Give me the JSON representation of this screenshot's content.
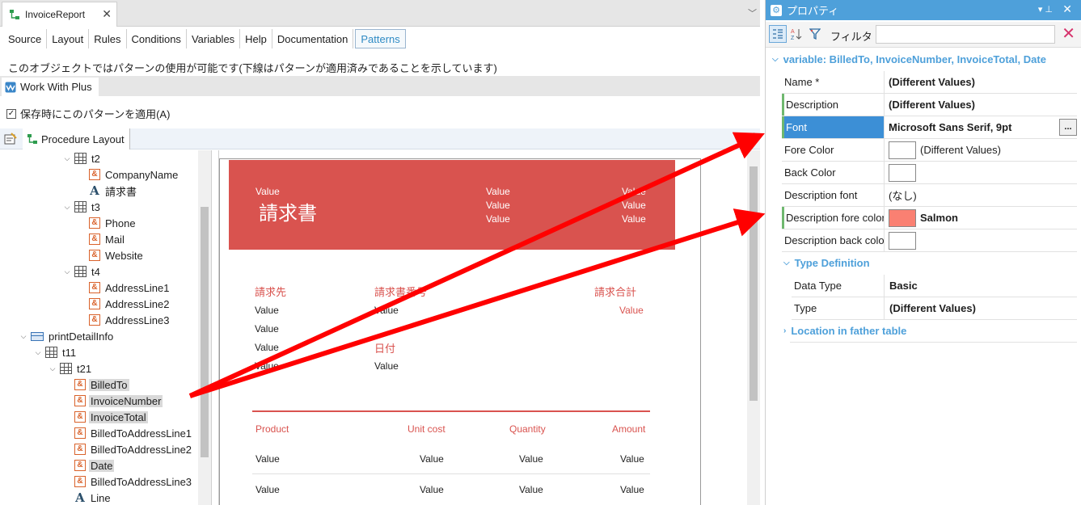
{
  "document_tab": {
    "title": "InvoiceReport"
  },
  "part_tabs": [
    "Source",
    "Layout",
    "Rules",
    "Conditions",
    "Variables",
    "Help",
    "Documentation",
    "Patterns"
  ],
  "pattern_info": "このオブジェクトではパターンの使用が可能です(下線はパターンが適用済みであることを示しています)",
  "pattern_tab": "Work With Plus",
  "apply_checkbox": {
    "label": "保存時にこのパターンを適用(A)",
    "checked": "✓"
  },
  "layout_tab": "Procedure Layout",
  "tree": {
    "t2": "t2",
    "company_name": "CompanyName",
    "seikyusho": "請求書",
    "t3": "t3",
    "phone": "Phone",
    "mail": "Mail",
    "website": "Website",
    "t4": "t4",
    "address1": "AddressLine1",
    "address2": "AddressLine2",
    "address3": "AddressLine3",
    "print_detail": "printDetailInfo",
    "t11": "t11",
    "t21": "t21",
    "billed_to": "BilledTo",
    "invoice_number": "InvoiceNumber",
    "invoice_total": "InvoiceTotal",
    "billed_addr1": "BilledToAddressLine1",
    "billed_addr2": "BilledToAddressLine2",
    "date": "Date",
    "billed_addr3": "BilledToAddressLine3",
    "line": "Line"
  },
  "canvas": {
    "value": "Value",
    "title": "請求書",
    "bill_to": "請求先",
    "invoice_no": "請求書番号",
    "invoice_total": "請求合計",
    "date_label": "日付",
    "columns": [
      "Product",
      "Unit cost",
      "Quantity",
      "Amount"
    ]
  },
  "props": {
    "title": "プロパティ",
    "filter_label": "フィルタ",
    "filter_value": "",
    "variable_header": "variable: BilledTo, InvoiceNumber, InvoiceTotal, Date",
    "rows": [
      {
        "name": "Name *",
        "value": "(Different Values)"
      },
      {
        "name": "Description",
        "value": "(Different Values)"
      },
      {
        "name": "Font",
        "value": "Microsoft Sans Serif, 9pt"
      },
      {
        "name": "Fore Color",
        "value": "(Different Values)"
      },
      {
        "name": "Back Color",
        "value": ""
      },
      {
        "name": "Description font",
        "value": "(なし)"
      },
      {
        "name": "Description fore color",
        "value": "Salmon"
      },
      {
        "name": "Description back color",
        "value": ""
      }
    ],
    "type_definition": {
      "header": "Type Definition",
      "rows": [
        {
          "name": "Data Type",
          "value": "Basic"
        },
        {
          "name": "Type",
          "value": "(Different Values)"
        }
      ]
    },
    "location_header": "Location in father table",
    "ellipsis": "...",
    "colors": {
      "salmon": "#fa8072",
      "accent": "#4ea0da",
      "banner": "#d9534f"
    }
  }
}
